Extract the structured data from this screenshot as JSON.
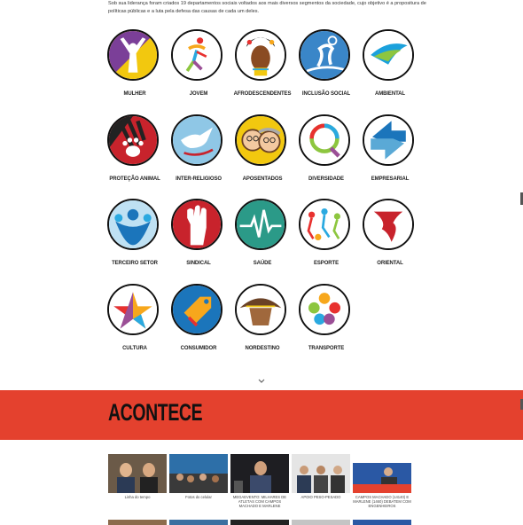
{
  "intro": {
    "text": "Sob sua liderança foram criados 19 departamentos sociais voltados aos mais diversos segmentos da sociedade, cujo objetivo é a propositura de políticas públicas e a luta pela defesa das causas de cada um deles."
  },
  "departments": [
    {
      "label": "MULHER",
      "icon": "woman-raised-arms-icon"
    },
    {
      "label": "JOVEM",
      "icon": "youth-figure-icon"
    },
    {
      "label": "AFRODESCENDENTES",
      "icon": "african-woman-icon"
    },
    {
      "label": "INCLUSÃO SOCIAL",
      "icon": "inclusion-figure-icon"
    },
    {
      "label": "AMBIENTAL",
      "icon": "environment-leaf-icon"
    },
    {
      "label": "PROTEÇÃO ANIMAL",
      "icon": "paw-print-icon"
    },
    {
      "label": "INTER-RELIGIOSO",
      "icon": "dove-icon"
    },
    {
      "label": "APOSENTADOS",
      "icon": "elderly-couple-icon"
    },
    {
      "label": "DIVERSIDADE",
      "icon": "rainbow-speech-bubble-icon"
    },
    {
      "label": "EMPRESARIAL",
      "icon": "business-arrows-icon"
    },
    {
      "label": "TERCEIRO SETOR",
      "icon": "people-group-icon"
    },
    {
      "label": "SINDICAL",
      "icon": "raised-fist-icon"
    },
    {
      "label": "SAÚDE",
      "icon": "heartbeat-line-icon"
    },
    {
      "label": "ESPORTE",
      "icon": "athletes-icon"
    },
    {
      "label": "ORIENTAL",
      "icon": "oriental-symbol-icon"
    },
    {
      "label": "CULTURA",
      "icon": "colorful-star-icon"
    },
    {
      "label": "CONSUMIDOR",
      "icon": "price-tag-icon"
    },
    {
      "label": "NORDESTINO",
      "icon": "cangaceiro-hat-icon"
    },
    {
      "label": "TRANSPORTE",
      "icon": "transport-modes-icon"
    }
  ],
  "acontece": {
    "heading": "ACONTECE"
  },
  "news": [
    {
      "caption": "Linha do tempo"
    },
    {
      "caption": "Fotos do celular"
    },
    {
      "caption": "MEGAEVENTO: MILHARES DE ATLETAS COM CAMPOS MACHADO E MARLENE"
    },
    {
      "caption": "APOIO PESO-PESADO"
    },
    {
      "caption": "CAMPOS MACHADO (14140) E MARLENE (1460) DEBATEM COM ENGENHEIROS"
    }
  ],
  "colors": {
    "band": "#e4412e",
    "text": "#222222"
  }
}
